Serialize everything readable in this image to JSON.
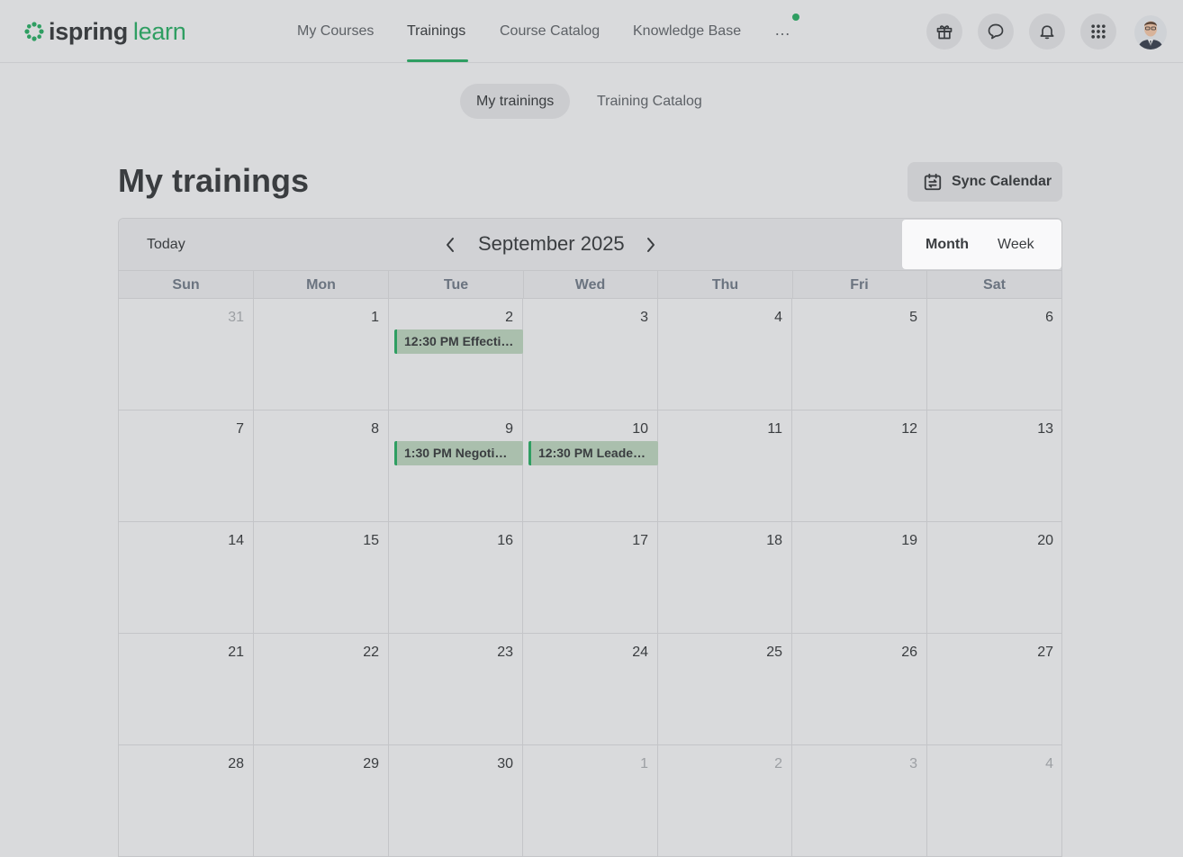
{
  "brand": {
    "name_a": "ispring",
    "name_b": "learn",
    "accent": "#2f9e62"
  },
  "nav": {
    "items": [
      {
        "label": "My Courses"
      },
      {
        "label": "Trainings"
      },
      {
        "label": "Course Catalog"
      },
      {
        "label": "Knowledge Base"
      }
    ],
    "active": "Trainings",
    "more_label": "…"
  },
  "header_icons": [
    "gift-icon",
    "chat-icon",
    "bell-icon",
    "apps-grid-icon",
    "user-avatar"
  ],
  "subtabs": [
    {
      "label": "My trainings",
      "active": true
    },
    {
      "label": "Training Catalog",
      "active": false
    }
  ],
  "page": {
    "title": "My trainings",
    "sync_label": "Sync Calendar"
  },
  "calendar": {
    "today_label": "Today",
    "month_label": "September 2025",
    "views": [
      "Month",
      "Week"
    ],
    "active_view": "Month",
    "weekdays": [
      "Sun",
      "Mon",
      "Tue",
      "Wed",
      "Thu",
      "Fri",
      "Sat"
    ],
    "weeks": [
      [
        "31",
        "1",
        "2",
        "3",
        "4",
        "5",
        "6"
      ],
      [
        "7",
        "8",
        "9",
        "10",
        "11",
        "12",
        "13"
      ],
      [
        "14",
        "15",
        "16",
        "17",
        "18",
        "19",
        "20"
      ],
      [
        "21",
        "22",
        "23",
        "24",
        "25",
        "26",
        "27"
      ],
      [
        "28",
        "29",
        "30",
        "1",
        "2",
        "3",
        "4"
      ]
    ],
    "events": [
      {
        "label": "12:30 PM Effecti…"
      },
      {
        "label": "1:30 PM Negoti…"
      },
      {
        "label": "12:30 PM Leade…"
      }
    ]
  }
}
